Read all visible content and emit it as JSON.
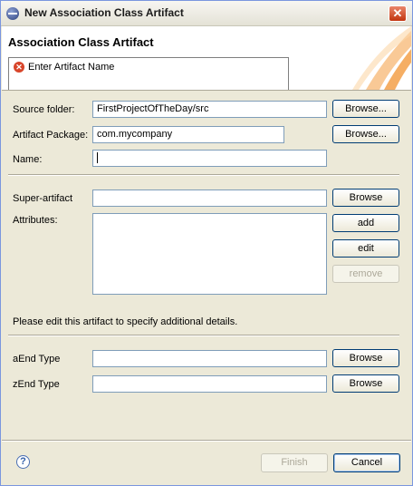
{
  "window": {
    "title": "New Association Class Artifact"
  },
  "header": {
    "title": "Association Class Artifact",
    "message": "Enter Artifact Name"
  },
  "form": {
    "source_folder": {
      "label": "Source folder:",
      "value": "FirstProjectOfTheDay/src",
      "button": "Browse..."
    },
    "artifact_package": {
      "label": "Artifact Package:",
      "value": "com.mycompany",
      "button": "Browse..."
    },
    "name": {
      "label": "Name:",
      "value": ""
    },
    "super_artifact": {
      "label": "Super-artifact",
      "value": "",
      "button": "Browse"
    },
    "attributes": {
      "label": "Attributes:",
      "add": "add",
      "edit": "edit",
      "remove": "remove"
    },
    "info": "Please edit this artifact to specify additional details.",
    "a_end": {
      "label": "aEnd Type",
      "value": "",
      "button": "Browse"
    },
    "z_end": {
      "label": "zEnd Type",
      "value": "",
      "button": "Browse"
    }
  },
  "footer": {
    "help": "?",
    "finish": "Finish",
    "cancel": "Cancel"
  },
  "icons": {
    "title": "eclipse-icon",
    "close": "close-icon",
    "error": "error-icon",
    "help": "help-icon"
  }
}
